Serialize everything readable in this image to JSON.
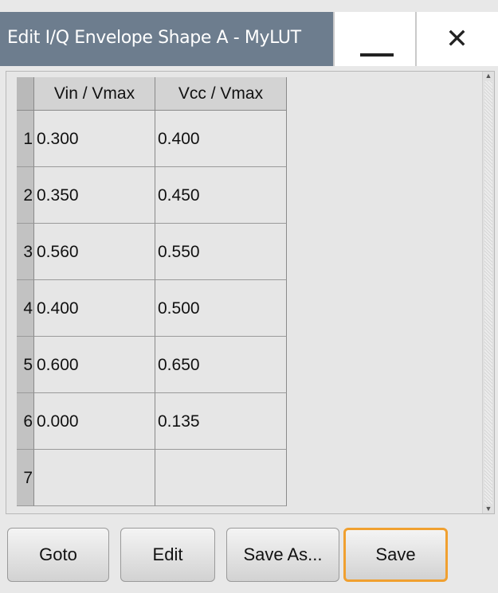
{
  "window": {
    "title": "Edit I/Q Envelope Shape A - MyLUT",
    "minimize_icon": "minimize-icon",
    "close_glyph": "✕"
  },
  "table": {
    "columns": [
      "Vin / Vmax",
      "Vcc / Vmax"
    ],
    "rows": [
      {
        "index": "1",
        "vin": "0.300",
        "vcc": "0.400"
      },
      {
        "index": "2",
        "vin": "0.350",
        "vcc": "0.450"
      },
      {
        "index": "3",
        "vin": "0.560",
        "vcc": "0.550"
      },
      {
        "index": "4",
        "vin": "0.400",
        "vcc": "0.500"
      },
      {
        "index": "5",
        "vin": "0.600",
        "vcc": "0.650"
      },
      {
        "index": "6",
        "vin": "0.000",
        "vcc": "0.135"
      },
      {
        "index": "7",
        "vin": "",
        "vcc": ""
      }
    ]
  },
  "buttons": {
    "goto": "Goto",
    "edit": "Edit",
    "save_as": "Save As...",
    "save": "Save"
  },
  "colors": {
    "title_bar": "#6d7d8e",
    "focus_border": "#f0a030"
  }
}
